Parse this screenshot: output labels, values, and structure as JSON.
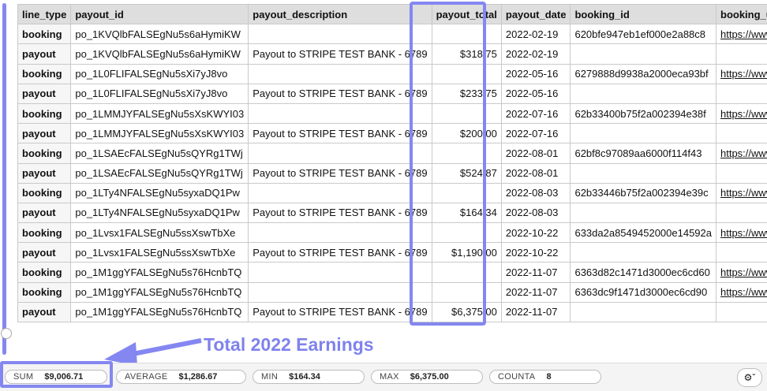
{
  "columns": [
    "line_type",
    "payout_id",
    "payout_description",
    "payout_total",
    "payout_date",
    "booking_id",
    "booking_url"
  ],
  "rows": [
    {
      "line_type": "booking",
      "payout_id": "po_1KVQlbFALSEgNu5s6aHymiKW",
      "payout_description": "",
      "payout_total": "",
      "payout_date": "2022-02-19",
      "booking_id": "620bfe947eb1ef000e2a88c8",
      "booking_url": "https://www.pee"
    },
    {
      "line_type": "payout",
      "payout_id": "po_1KVQlbFALSEgNu5s6aHymiKW",
      "payout_description": "Payout to STRIPE TEST BANK - 6789",
      "payout_total": "$318.75",
      "payout_date": "2022-02-19",
      "booking_id": "",
      "booking_url": ""
    },
    {
      "line_type": "booking",
      "payout_id": "po_1L0FLIFALSEgNu5sXi7yJ8vo",
      "payout_description": "",
      "payout_total": "",
      "payout_date": "2022-05-16",
      "booking_id": "6279888d9938a2000eca93bf",
      "booking_url": "https://www.pee"
    },
    {
      "line_type": "payout",
      "payout_id": "po_1L0FLIFALSEgNu5sXi7yJ8vo",
      "payout_description": "Payout to STRIPE TEST BANK - 6789",
      "payout_total": "$233.75",
      "payout_date": "2022-05-16",
      "booking_id": "",
      "booking_url": ""
    },
    {
      "line_type": "booking",
      "payout_id": "po_1LMMJYFALSEgNu5sXsKWYI03",
      "payout_description": "",
      "payout_total": "",
      "payout_date": "2022-07-16",
      "booking_id": "62b33400b75f2a002394e38f",
      "booking_url": "https://www.pee"
    },
    {
      "line_type": "payout",
      "payout_id": "po_1LMMJYFALSEgNu5sXsKWYI03",
      "payout_description": "Payout to STRIPE TEST BANK - 6789",
      "payout_total": "$200.00",
      "payout_date": "2022-07-16",
      "booking_id": "",
      "booking_url": ""
    },
    {
      "line_type": "booking",
      "payout_id": "po_1LSAEcFALSEgNu5sQYRg1TWj",
      "payout_description": "",
      "payout_total": "",
      "payout_date": "2022-08-01",
      "booking_id": "62bf8c97089aa6000f114f43",
      "booking_url": "https://www.pee"
    },
    {
      "line_type": "payout",
      "payout_id": "po_1LSAEcFALSEgNu5sQYRg1TWj",
      "payout_description": "Payout to STRIPE TEST BANK - 6789",
      "payout_total": "$524.87",
      "payout_date": "2022-08-01",
      "booking_id": "",
      "booking_url": ""
    },
    {
      "line_type": "booking",
      "payout_id": "po_1LTy4NFALSEgNu5syxaDQ1Pw",
      "payout_description": "",
      "payout_total": "",
      "payout_date": "2022-08-03",
      "booking_id": "62b33446b75f2a002394e39c",
      "booking_url": "https://www.pee"
    },
    {
      "line_type": "payout",
      "payout_id": "po_1LTy4NFALSEgNu5syxaDQ1Pw",
      "payout_description": "Payout to STRIPE TEST BANK - 6789",
      "payout_total": "$164.34",
      "payout_date": "2022-08-03",
      "booking_id": "",
      "booking_url": ""
    },
    {
      "line_type": "booking",
      "payout_id": "po_1Lvsx1FALSEgNu5ssXswTbXe",
      "payout_description": "",
      "payout_total": "",
      "payout_date": "2022-10-22",
      "booking_id": "633da2a8549452000e14592a",
      "booking_url": "https://www.pee"
    },
    {
      "line_type": "payout",
      "payout_id": "po_1Lvsx1FALSEgNu5ssXswTbXe",
      "payout_description": "Payout to STRIPE TEST BANK - 6789",
      "payout_total": "$1,190.00",
      "payout_date": "2022-10-22",
      "booking_id": "",
      "booking_url": ""
    },
    {
      "line_type": "booking",
      "payout_id": "po_1M1ggYFALSEgNu5s76HcnbTQ",
      "payout_description": "",
      "payout_total": "",
      "payout_date": "2022-11-07",
      "booking_id": "6363d82c1471d3000ec6cd60",
      "booking_url": "https://www.pee"
    },
    {
      "line_type": "booking",
      "payout_id": "po_1M1ggYFALSEgNu5s76HcnbTQ",
      "payout_description": "",
      "payout_total": "",
      "payout_date": "2022-11-07",
      "booking_id": "6363dc9f1471d3000ec6cd90",
      "booking_url": "https://www.pee"
    },
    {
      "line_type": "payout",
      "payout_id": "po_1M1ggYFALSEgNu5s76HcnbTQ",
      "payout_description": "Payout to STRIPE TEST BANK - 6789",
      "payout_total": "$6,375.00",
      "payout_date": "2022-11-07",
      "booking_id": "",
      "booking_url": ""
    }
  ],
  "annotation": {
    "text": "Total 2022 Earnings",
    "color": "#7f82ec"
  },
  "accent_color": "#8487f0",
  "summary": {
    "sum_label": "SUM",
    "sum_value": "$9,006.71",
    "average_label": "AVERAGE",
    "average_value": "$1,286.67",
    "min_label": "MIN",
    "min_value": "$164.34",
    "max_label": "MAX",
    "max_value": "$6,375.00",
    "counta_label": "COUNTA",
    "counta_value": "8"
  },
  "settings_icon": "gear-icon"
}
